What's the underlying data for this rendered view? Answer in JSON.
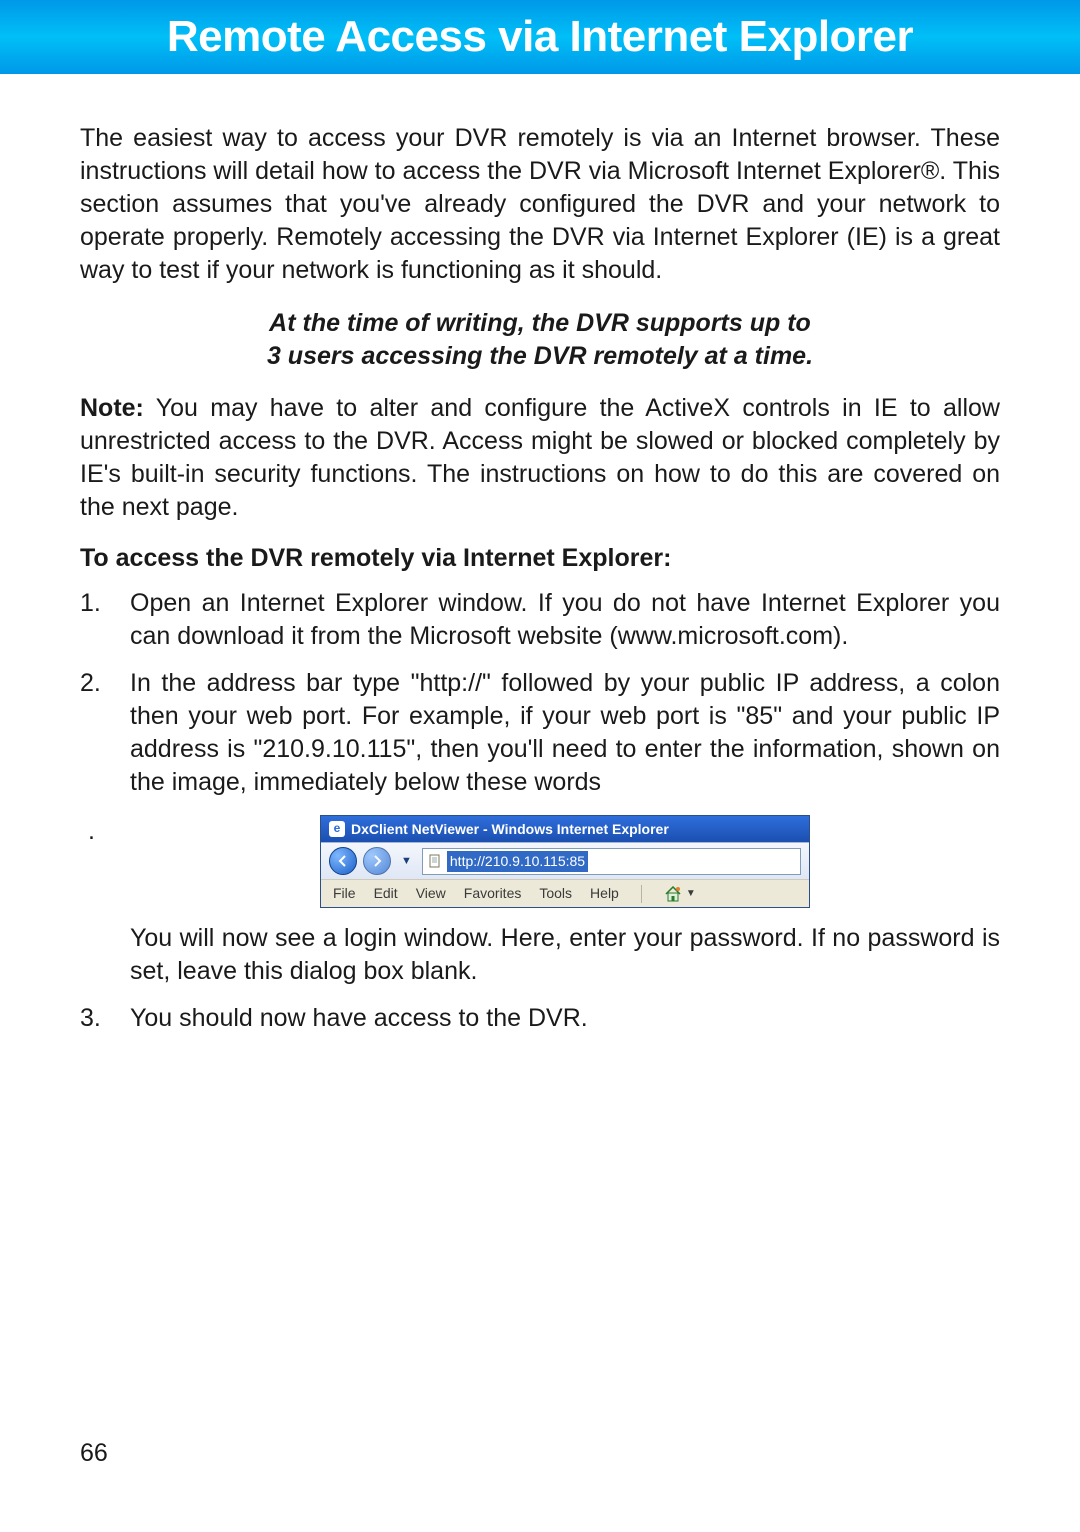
{
  "banner": {
    "title": "Remote Access via Internet Explorer"
  },
  "intro": "The easiest way to access your DVR remotely is via an Internet browser. These instructions will detail how to access the DVR via Microsoft Internet Explorer®. This section assumes that you've already configured the DVR and your network to operate properly. Remotely accessing the DVR via Internet Explorer (IE) is a great way to test if your network is functioning as it should.",
  "callout": {
    "line1": "At the time of writing, the DVR supports up to",
    "line2": "3 users accessing the DVR remotely at a time."
  },
  "note": {
    "label": "Note:",
    "text": " You may have to alter and configure the ActiveX controls in IE to allow unrestricted access to the DVR. Access might be slowed or blocked completely by IE's built-in security functions. The instructions on how to do this are covered on the next page."
  },
  "subhead": "To access the DVR remotely via Internet Explorer:",
  "steps": {
    "s1": "Open an Internet Explorer window. If you do not have Internet Explorer you can download it from the Microsoft website (www.microsoft.com).",
    "s2": "In the address bar type \"http://\" followed by your public IP address, a colon then your web port. For example, if your web port is \"85\" and your public IP address is \"210.9.10.115\", then you'll need to enter the information, shown on the image, immediately below these words",
    "s2b": "You will now see a login window. Here, enter your password. If no password is set, leave this dialog box blank.",
    "s3": "You should now have access to the DVR."
  },
  "ie": {
    "title": "DxClient NetViewer - Windows Internet Explorer",
    "url": "http://210.9.10.115:85",
    "menus": [
      "File",
      "Edit",
      "View",
      "Favorites",
      "Tools",
      "Help"
    ]
  },
  "page_number": "66"
}
